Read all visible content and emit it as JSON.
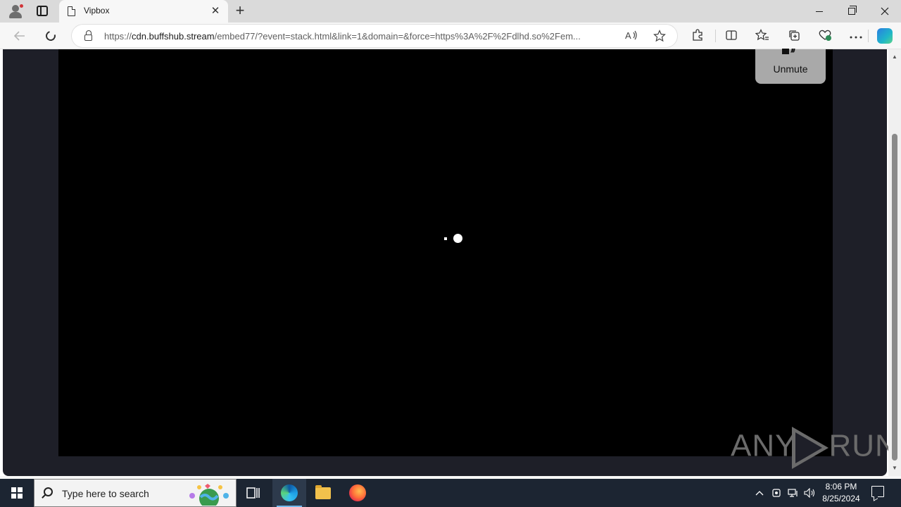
{
  "browser": {
    "tab": {
      "title": "Vipbox",
      "close_glyph": "✕"
    },
    "new_tab_glyph": "+",
    "address": {
      "url_prefix": "https://",
      "url_host": "cdn.buffshub.stream",
      "url_rest": "/embed77/?event=stack.html&link=1&domain=&force=https%3A%2F%2Fdlhd.so%2Fem..."
    },
    "icons": {
      "back": "arrow-left-icon",
      "refresh": "refresh-icon",
      "read_aloud": "read-aloud-icon",
      "favorite": "star-icon",
      "extensions": "puzzle-icon",
      "split": "split-screen-icon",
      "favorites": "favorites-icon",
      "collections": "collections-icon",
      "performance": "heart-icon",
      "more": "more-icon",
      "copilot": "copilot-icon"
    }
  },
  "page": {
    "unmute_label": "Unmute",
    "watermark_left": "ANY",
    "watermark_right": "RUN",
    "colors": {
      "frame": "#1e1f28",
      "player": "#000000",
      "unmute_bg": "#a9a9a9"
    }
  },
  "taskbar": {
    "search_placeholder": "Type here to search",
    "time": "8:06 PM",
    "date": "8/25/2024",
    "colors": {
      "bg": "#1c2532",
      "active_indicator": "#76b9ed"
    }
  }
}
